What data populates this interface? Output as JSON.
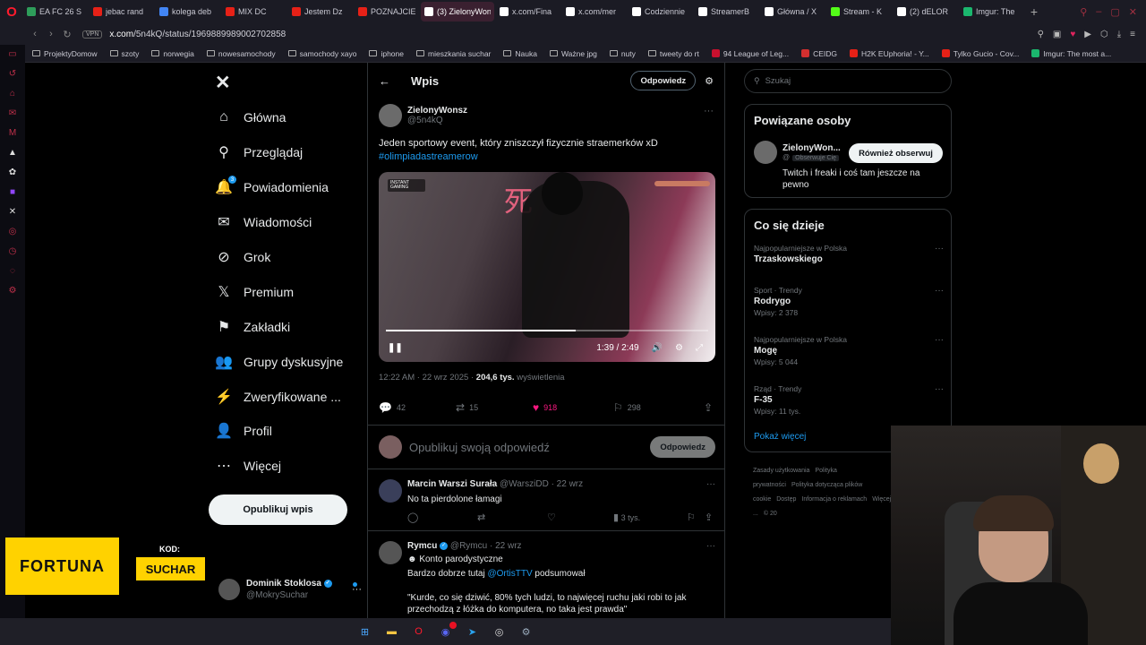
{
  "browser": {
    "tabs": [
      {
        "label": "EA FC 26 S",
        "color": "#2e9d5a"
      },
      {
        "label": "jebac rand",
        "color": "#e62117"
      },
      {
        "label": "kolega deb",
        "color": "#4285f4"
      },
      {
        "label": "MIX DC",
        "color": "#e62117"
      },
      {
        "label": "Jestem Dz",
        "color": "#e62117"
      },
      {
        "label": "POZNAJCIE",
        "color": "#e62117"
      },
      {
        "label": "(3) ZielonyWons",
        "color": "#ffffff",
        "active": true
      },
      {
        "label": "x.com/Fina",
        "color": "#ffffff"
      },
      {
        "label": "x.com/mer",
        "color": "#ffffff"
      },
      {
        "label": "Codziennie",
        "color": "#ffffff"
      },
      {
        "label": "StreamerB",
        "color": "#ffffff"
      },
      {
        "label": "Główna / X",
        "color": "#ffffff"
      },
      {
        "label": "Stream - K",
        "color": "#53fc18"
      },
      {
        "label": "(2) dELOR",
        "color": "#ffffff"
      },
      {
        "label": "Imgur: The",
        "color": "#1bb76e"
      }
    ],
    "vpn_label": "VPN",
    "url_host": "x.com",
    "url_path": "/5n4kQ/status/1969889989002702858",
    "bookmarks": [
      {
        "label": "ProjektyDomow",
        "kind": "folder"
      },
      {
        "label": "szoty",
        "kind": "folder"
      },
      {
        "label": "norwegia",
        "kind": "folder"
      },
      {
        "label": "nowesamochody",
        "kind": "folder"
      },
      {
        "label": "samochody xayo",
        "kind": "folder"
      },
      {
        "label": "iphone",
        "kind": "folder"
      },
      {
        "label": "mieszkania suchar",
        "kind": "folder"
      },
      {
        "label": "Nauka",
        "kind": "folder"
      },
      {
        "label": "Ważne jpg",
        "kind": "folder"
      },
      {
        "label": "nuty",
        "kind": "folder"
      },
      {
        "label": "tweety do rt",
        "kind": "folder"
      },
      {
        "label": "94 League of Leg...",
        "kind": "site",
        "color": "#c8102e"
      },
      {
        "label": "CEIDG",
        "kind": "site",
        "color": "#d32f2f"
      },
      {
        "label": "H2K EUphoria! - Y...",
        "kind": "site",
        "color": "#e62117"
      },
      {
        "label": "Tylko Gucio - Cov...",
        "kind": "site",
        "color": "#e62117"
      },
      {
        "label": "Imgur: The most a...",
        "kind": "site",
        "color": "#1bb76e"
      }
    ]
  },
  "x": {
    "nav": [
      {
        "id": "home",
        "label": "Główna",
        "icon": "⌂",
        "icon_name": "home-icon"
      },
      {
        "id": "explore",
        "label": "Przeglądaj",
        "icon": "⚲",
        "icon_name": "search-icon"
      },
      {
        "id": "notifications",
        "label": "Powiadomienia",
        "icon": "🔔",
        "icon_name": "bell-icon",
        "badge": "3"
      },
      {
        "id": "messages",
        "label": "Wiadomości",
        "icon": "✉",
        "icon_name": "mail-icon"
      },
      {
        "id": "grok",
        "label": "Grok",
        "icon": "⊘",
        "icon_name": "grok-icon"
      },
      {
        "id": "premium",
        "label": "Premium",
        "icon": "𝕏",
        "icon_name": "x-premium-icon"
      },
      {
        "id": "bookmarks",
        "label": "Zakładki",
        "icon": "⚑",
        "icon_name": "bookmark-icon"
      },
      {
        "id": "groups",
        "label": "Grupy dyskusyjne",
        "icon": "👥",
        "icon_name": "communities-icon"
      },
      {
        "id": "verified",
        "label": "Zweryfikowane ...",
        "icon": "⚡",
        "icon_name": "lightning-icon"
      },
      {
        "id": "profile",
        "label": "Profil",
        "icon": "👤",
        "icon_name": "person-icon"
      },
      {
        "id": "more",
        "label": "Więcej",
        "icon": "⋯",
        "icon_name": "more-circle-icon"
      }
    ],
    "post_button": "Opublikuj wpis",
    "account": {
      "name": "Dominik Stoklosa",
      "handle": "@MokrySuchar"
    },
    "header_title": "Wpis",
    "header_reply": "Odpowiedz",
    "tweet": {
      "author_name": "ZielonyWonsz",
      "author_handle": "@5n4kQ",
      "text": "Jeden sportowy event, który zniszczył fizycznie straemerków xD",
      "hashtag": "#olimpiadastreamerow",
      "video_badge": "INSTANT GAMING",
      "video_progress": 0.59,
      "video_time": "1:39 / 2:49",
      "time": "12:22 AM · 22 wrz 2025 · ",
      "views": "204,6 tys.",
      "views_label": " wyświetlenia",
      "replies": "42",
      "retweets": "15",
      "likes": "918",
      "bookmarks": "298"
    },
    "compose_placeholder": "Opublikuj swoją odpowiedź",
    "compose_button": "Odpowiedz",
    "replies": [
      {
        "name": "Marcin Warszi Surała",
        "handle": "@WarsziDD",
        "date": " · 22 wrz",
        "text": "No ta pierdolone łamagi",
        "views": "3 tys."
      },
      {
        "name": "Rymcu",
        "handle": "@Rymcu",
        "date": " · 22 wrz",
        "parody": "Konto parodystyczne",
        "text_pre": "Bardzo dobrze tutaj ",
        "mention": "@OrtisTTV",
        "text_post": " podsumował",
        "quote": "\"Kurde, co się dziwić, 80% tych ludzi, to najwięcej ruchu jaki robi to jak przechodzą z łóżka do komputera, no taka jest prawda\""
      }
    ],
    "search_placeholder": "Szukaj",
    "related_title": "Powiązane osoby",
    "related": {
      "name": "ZielonyWon...",
      "handle": "@",
      "follows_you": "Obserwuje Cię",
      "follow_button": "Również obserwuj",
      "bio": "Twitch i freaki i coś tam jeszcze na pewno"
    },
    "trends_title": "Co się dzieje",
    "trends": [
      {
        "context": "Najpopularniejsze w Polska",
        "name": "Trzaskowskiego",
        "posts": ""
      },
      {
        "context": "Sport · Trendy",
        "name": "Rodrygo",
        "posts": "Wpisy: 2 378"
      },
      {
        "context": "Najpopularniejsze w Polska",
        "name": "Mogę",
        "posts": "Wpisy: 5 044"
      },
      {
        "context": "Rząd · Trendy",
        "name": "F-35",
        "posts": "Wpisy: 11 tys."
      }
    ],
    "show_more": "Pokaż więcej",
    "footer": [
      "Zasady użytkowania",
      "Polityka prywatności",
      "Polityka dotycząca plików cookie",
      "Dostęp",
      "Informacja o reklamach",
      "Więcej ...",
      "© 20"
    ]
  },
  "overlay": {
    "sponsor": "FORTUNA",
    "code_label": "KOD:",
    "code": "SUCHAR"
  },
  "colors": {
    "accent": "#1d9bf0",
    "like": "#f91880",
    "sponsor": "#ffd200"
  }
}
